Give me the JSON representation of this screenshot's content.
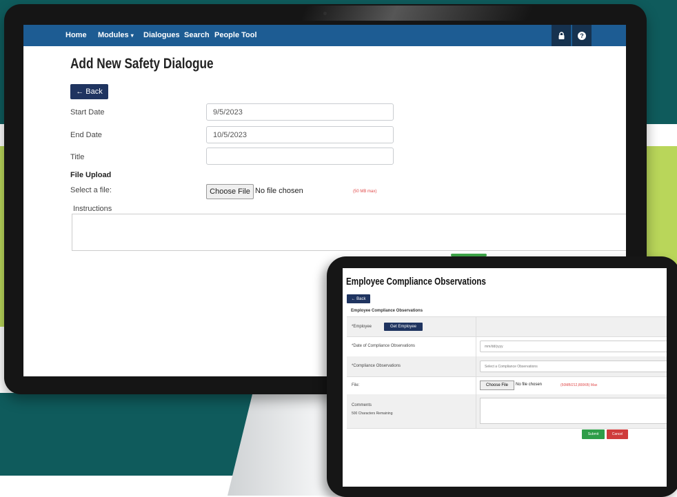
{
  "monitor": {
    "navbar": {
      "links": [
        "Home",
        "Modules",
        "Dialogues",
        "Search",
        "People Tool"
      ],
      "modules_caret": "▾",
      "lock_icon": "lock-icon",
      "help_icon": "help-icon",
      "help_glyph": "?",
      "color": "#1d5c93"
    },
    "page": {
      "title": "Add New Safety Dialogue",
      "back_button": "← Back",
      "start_date_label": "Start Date",
      "start_date_value": "9/5/2023",
      "end_date_label": "End Date",
      "end_date_value": "10/5/2023",
      "title_label": "Title",
      "title_value": "",
      "file_upload_heading": "File Upload",
      "select_file_label": "Select a file:",
      "choose_file_button": "Choose File",
      "no_file_text": "No file chosen",
      "file_size_hint": "(50 MB max)",
      "instructions_label": "Instructions"
    }
  },
  "tablet": {
    "title": "Employee Compliance Observations",
    "back_button": "← Back",
    "subtitle": "Employee Compliance Observations",
    "employee_label": "*Employee",
    "get_employee_button": "Get Employee",
    "date_label": "*Date of Compliance Observations",
    "date_placeholder": "mm/dd/yyyy",
    "compliance_label": "*Compliance Observations",
    "compliance_placeholder": "Select a Compliance Observations",
    "file_label": "File:",
    "choose_file_button": "Choose File",
    "no_file_text": "No file chosen",
    "file_size_hint": "(50MB/212,800KB) Max",
    "comments_label": "Comments",
    "comments_remaining": "500 Characters Remaining",
    "submit_button": "Submit",
    "cancel_button": "Cancel"
  }
}
